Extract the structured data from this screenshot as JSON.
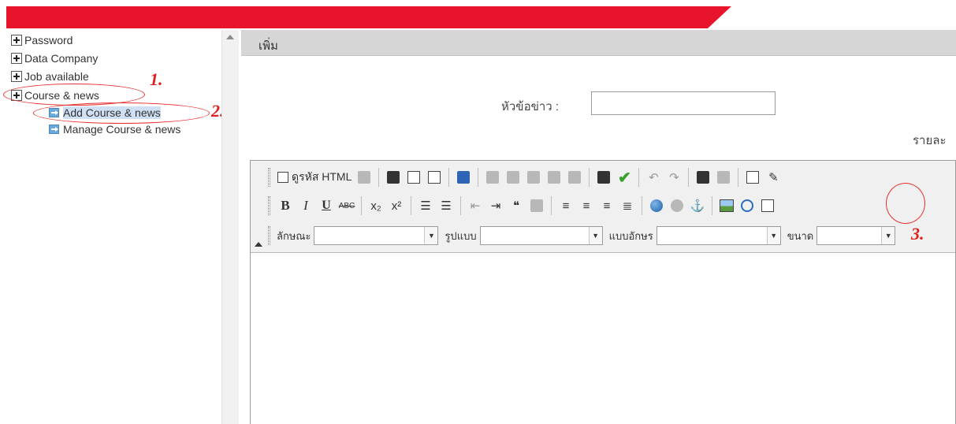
{
  "colors": {
    "banner": "#e8142b",
    "annotation": "#e02020",
    "header_bar": "#d6d6d6",
    "selected_item": "#cfe0f5"
  },
  "tree": {
    "items": [
      {
        "label": "Password",
        "icon": "plus-box-icon"
      },
      {
        "label": "Data Company",
        "icon": "plus-box-icon"
      },
      {
        "label": "Job available",
        "icon": "plus-box-icon"
      },
      {
        "label": "Course & news",
        "icon": "plus-box-icon"
      }
    ],
    "children": [
      {
        "label": "Add Course & news",
        "icon": "arrow-icon",
        "selected": true
      },
      {
        "label": "Manage Course & news",
        "icon": "arrow-icon",
        "selected": false
      }
    ]
  },
  "annotations": [
    "1.",
    "2.",
    "3."
  ],
  "header": {
    "title": "เพิ่ม"
  },
  "form": {
    "title_label": "หัวข้อข่าว :",
    "title_value": "",
    "detail_label": "รายละ"
  },
  "editor": {
    "source_label": "ดูรหัส HTML",
    "bold": "B",
    "italic": "I",
    "underline": "U",
    "strike": "ABC",
    "subscript": "x₂",
    "superscript": "x²",
    "quote": "❝",
    "style_label": "ลักษณะ",
    "format_label": "รูปแบบ",
    "font_label": "แบบอักษร",
    "size_label": "ขนาด",
    "style_value": "",
    "format_value": "",
    "font_value": "",
    "size_value": ""
  }
}
